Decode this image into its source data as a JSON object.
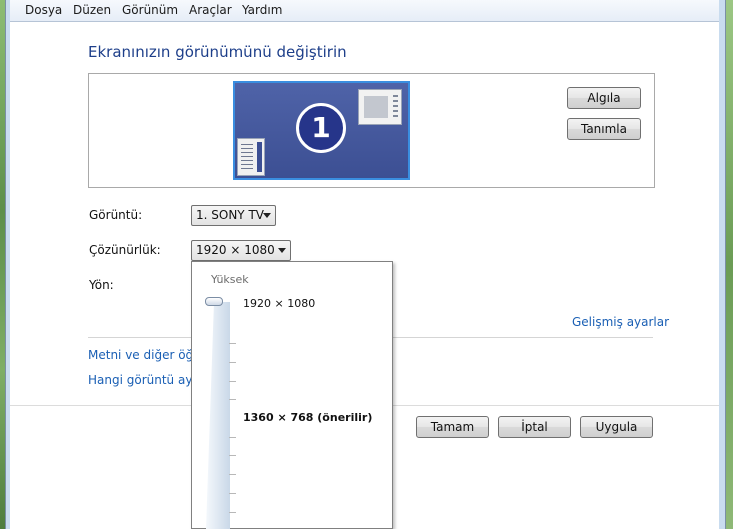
{
  "menu": {
    "items": [
      {
        "label": "Dosya"
      },
      {
        "label": "Düzen"
      },
      {
        "label": "Görünüm"
      },
      {
        "label": "Araçlar"
      },
      {
        "label": "Yardım"
      }
    ]
  },
  "page": {
    "title": "Ekranınızın görünümünü değiştirin"
  },
  "monitor_preview": {
    "number": "1",
    "detect_label": "Algıla",
    "identify_label": "Tanımla"
  },
  "settings": {
    "display_label": "Görüntü:",
    "display_value": "1. SONY TV",
    "resolution_label": "Çözünürlük:",
    "resolution_value": "1920 × 1080",
    "orientation_label": "Yön:",
    "advanced_link": "Gelişmiş ayarlar"
  },
  "links": {
    "text_size": "Metni ve diğer öğel",
    "which_display": "Hangi görüntü ayar"
  },
  "resolution_popup": {
    "heading": "Yüksek",
    "options": [
      {
        "label": "1920 × 1080",
        "selected": true
      },
      {
        "label": "1360 × 768 (önerilir)",
        "recommended": true
      }
    ]
  },
  "actions": {
    "ok_label": "Tamam",
    "cancel_label": "İptal",
    "apply_label": "Uygula"
  },
  "colors": {
    "title": "#1e3f8a",
    "link": "#1a5fb4",
    "monitor_fill": "#3c4f93",
    "monitor_border": "#3a8ee0"
  }
}
